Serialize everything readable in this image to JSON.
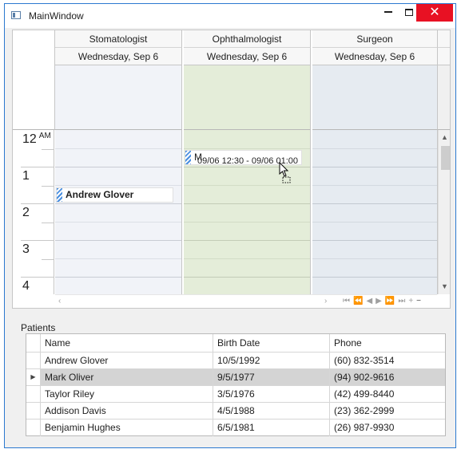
{
  "window": {
    "title": "MainWindow",
    "close_glyph": "✕"
  },
  "scheduler": {
    "resources": [
      {
        "name": "Stomatologist",
        "date": "Wednesday, Sep 6",
        "color": "#f1f3f8"
      },
      {
        "name": "Ophthalmologist",
        "date": "Wednesday, Sep 6",
        "color": "#e4edd9"
      },
      {
        "name": "Surgeon",
        "date": "Wednesday, Sep 6",
        "color": "#e6ebf1"
      }
    ],
    "hours": [
      {
        "label": "12",
        "ampm": "AM"
      },
      {
        "label": "1",
        "ampm": ""
      },
      {
        "label": "2",
        "ampm": ""
      },
      {
        "label": "3",
        "ampm": ""
      },
      {
        "label": "4",
        "ampm": ""
      }
    ],
    "appointments": {
      "andrew": "Andrew Glover",
      "mark_prefix": "M"
    },
    "drag_tooltip": "09/06 12:30 - 09/06 01:00"
  },
  "patients": {
    "label": "Patients",
    "columns": [
      "Name",
      "Birth Date",
      "Phone"
    ],
    "rows": [
      {
        "name": "Andrew Glover",
        "birth": "10/5/1992",
        "phone": "(60) 832-3514"
      },
      {
        "name": "Mark Oliver",
        "birth": "9/5/1977",
        "phone": "(94) 902-9616"
      },
      {
        "name": "Taylor Riley",
        "birth": "3/5/1976",
        "phone": "(42) 499-8440"
      },
      {
        "name": "Addison Davis",
        "birth": "4/5/1988",
        "phone": "(23) 362-2999"
      },
      {
        "name": "Benjamin Hughes",
        "birth": "6/5/1981",
        "phone": "(26) 987-9930"
      }
    ],
    "selected_index": 1,
    "row_indicator": "▶"
  }
}
